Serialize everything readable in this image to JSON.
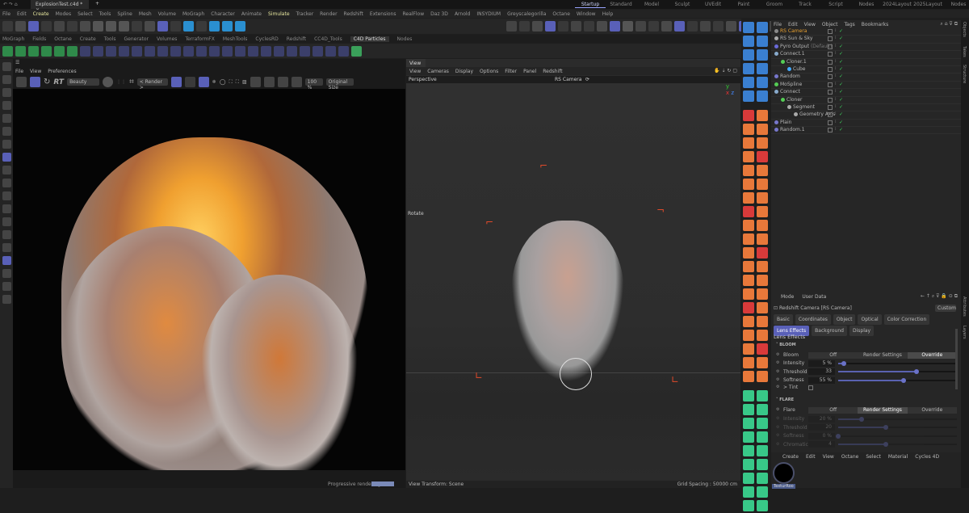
{
  "titlebar": {
    "file_tab": "ExplosionTest.c4d *",
    "layouts": [
      "Startup",
      "Standard",
      "Model",
      "Sculpt",
      "UVEdit",
      "Paint",
      "Groom",
      "Track",
      "Script",
      "Nodes",
      "2024Layout",
      "2025Layout",
      "Nodes"
    ],
    "active_layout": "Startup"
  },
  "menubar": [
    "File",
    "Edit",
    "Create",
    "Modes",
    "Select",
    "Tools",
    "Spline",
    "Mesh",
    "Volume",
    "MoGraph",
    "Character",
    "Animate",
    "Simulate",
    "Tracker",
    "Render",
    "Redshift",
    "Extensions",
    "RealFlow",
    "Daz 3D",
    "Arnold",
    "INSYDIUM",
    "Greyscalegorilla",
    "Octane",
    "Window",
    "Help"
  ],
  "toolbar1_icons": [
    "undo-icon",
    "redo-icon",
    "select-icon",
    "move-icon",
    "scale-icon",
    "rotate-icon",
    "recent-icon",
    "x-axis-icon",
    "y-axis-icon",
    "z-axis-icon",
    "coord-icon",
    "render-region-icon",
    "render-view-icon",
    "render-settings-icon",
    "cube-icon",
    "pen-icon",
    "cloner-icon",
    "mograph-icon",
    "deformer-icon",
    "scene-icon",
    "eraser-icon",
    "nodes-icon",
    "hierarchy-icon",
    "numbers-icon",
    "viewport-layout-icon",
    "camera-icon",
    "floor-icon",
    "light-icon",
    "axis-icon",
    "snap-icon",
    "workplane-icon",
    "brush-icon",
    "play-icon",
    "keyframe-icon",
    "timeline-icon",
    "fcurve-icon",
    "tracker-icon",
    "particles-icon",
    "material-icon",
    "archive-icon",
    "link-icon",
    "redshift-icon"
  ],
  "palette_tabs": [
    "MoGraph",
    "Fields",
    "Octane",
    "Create",
    "Tools",
    "Generator",
    "Volumes",
    "TerraformFX",
    "MeshTools",
    "CyclesRD",
    "Redshift",
    "CC4D_Tools",
    "C4D Particles",
    "Nodes"
  ],
  "active_palette": "C4D Particles",
  "toolbar2_icons": [
    "emitter-icon",
    "particles-icon",
    "flow-icon",
    "group-icon",
    "folder-icon",
    "modifier-icon",
    "shape-icon",
    "speed-icon",
    "pull-icon",
    "sigma-icon",
    "kill-icon",
    "spawn-icon",
    "view-icon",
    "rotate-icon",
    "blend-icon",
    "align-icon",
    "grid-icon",
    "drop-icon",
    "field-icon",
    "magnet-icon",
    "spiral-icon",
    "turbulence-icon",
    "wind-icon",
    "drag-icon",
    "orbit-icon",
    "vortex-icon",
    "attract-icon",
    "leaf-icon"
  ],
  "render_view": {
    "menu": [
      "File",
      "View",
      "Preferences"
    ],
    "rt_label": "RT",
    "aov": "Beauty",
    "camera": "< Render >",
    "zoom": "100 %",
    "size": "Original Size",
    "status": "Progressive rendering"
  },
  "viewport": {
    "tab": "View",
    "menu": [
      "View",
      "Cameras",
      "Display",
      "Options",
      "Filter",
      "Panel",
      "Redshift"
    ],
    "projection": "Perspective",
    "camera": "RS Camera",
    "hud": "Rotate",
    "status_left": "View Transform: Scene",
    "status_right": "Grid Spacing : 50000 cm"
  },
  "object_manager": {
    "menu": [
      "File",
      "Edit",
      "View",
      "Object",
      "Tags",
      "Bookmarks"
    ],
    "objects": [
      {
        "name": "RS Camera",
        "depth": 0,
        "color": "#e8a030",
        "dot": "#888"
      },
      {
        "name": "RS Sun & Sky",
        "depth": 0,
        "color": "#b8b8b8",
        "dot": "#aaa"
      },
      {
        "name": "Pyro Output",
        "suffix": "(Default)",
        "depth": 0,
        "color": "#b8b8b8",
        "dot": "#6a6ad8"
      },
      {
        "name": "Connect.1",
        "depth": 0,
        "color": "#b8b8b8",
        "dot": "#8ac"
      },
      {
        "name": "Cloner.1",
        "depth": 1,
        "color": "#b8b8b8",
        "dot": "#5c5"
      },
      {
        "name": "Cube",
        "depth": 2,
        "color": "#b8b8b8",
        "dot": "#4af"
      },
      {
        "name": "Random",
        "depth": 0,
        "color": "#b8b8b8",
        "dot": "#77c"
      },
      {
        "name": "MoSpline",
        "depth": 0,
        "color": "#b8b8b8",
        "dot": "#5c5"
      },
      {
        "name": "Connect",
        "depth": 0,
        "color": "#b8b8b8",
        "dot": "#8ac"
      },
      {
        "name": "Cloner",
        "depth": 1,
        "color": "#b8b8b8",
        "dot": "#5c5"
      },
      {
        "name": "Segment",
        "depth": 2,
        "color": "#b8b8b8",
        "dot": "#aaa"
      },
      {
        "name": "Geometry Axis",
        "depth": 3,
        "color": "#b8b8b8",
        "dot": "#aaa"
      },
      {
        "name": "Plain",
        "depth": 0,
        "color": "#b8b8b8",
        "dot": "#77c"
      },
      {
        "name": "Random.1",
        "depth": 0,
        "color": "#b8b8b8",
        "dot": "#77c"
      }
    ]
  },
  "side_tabs": [
    "Objects",
    "Takes",
    "Structure",
    "Attributes",
    "Layers"
  ],
  "attributes": {
    "menu": [
      "Mode",
      "User Data"
    ],
    "object": "Redshift Camera [RS Camera]",
    "preset": "Custom",
    "tabs": [
      "Basic",
      "Coordinates",
      "Object",
      "Optical",
      "Color Correction",
      "Lens Effects",
      "Background",
      "Display"
    ],
    "active_tab": "Lens Effects",
    "section": "Lens Effects",
    "bloom": {
      "title": "BLOOM",
      "label": "Bloom",
      "modes": [
        "Off",
        "Render Settings",
        "Override"
      ],
      "active": "Override",
      "params": [
        {
          "label": "Intensity",
          "value": "5 %",
          "fraction": 0.05
        },
        {
          "label": "Threshold",
          "value": "33",
          "fraction": 0.66
        },
        {
          "label": "Softness",
          "value": "55 %",
          "fraction": 0.55
        }
      ],
      "tint": "> Tint"
    },
    "flare": {
      "title": "FLARE",
      "label": "Flare",
      "modes": [
        "Off",
        "Render Settings",
        "Override"
      ],
      "active": "Render Settings",
      "params": [
        {
          "label": "Intensity",
          "value": "20 %",
          "fraction": 0.2
        },
        {
          "label": "Threshold",
          "value": "20",
          "fraction": 0.4
        },
        {
          "label": "Softness",
          "value": "0 %",
          "fraction": 0.0
        },
        {
          "label": "Chromatic",
          "value": "4",
          "fraction": 0.4
        }
      ]
    }
  },
  "material_manager": {
    "menu": [
      "Create",
      "Edit",
      "View",
      "Octane",
      "Select",
      "Material",
      "Cycles 4D"
    ],
    "material": "TexturRoo"
  }
}
